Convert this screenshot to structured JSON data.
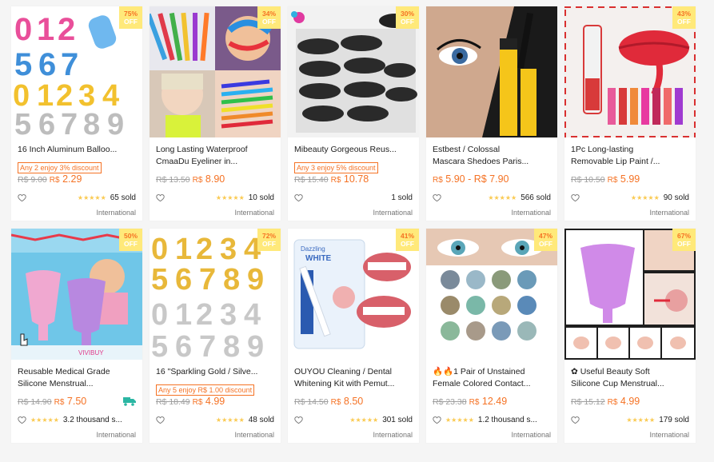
{
  "products": [
    {
      "title": "16 Inch Aluminum Balloo...",
      "title2": "",
      "promo": "Any 2 enjoy 3% discount",
      "old_price": "R$ 9.00",
      "cur": "R$",
      "price": "2.29",
      "stars": "★★★★★",
      "sold": "65 sold",
      "origin": "International",
      "discount_pct": "75%",
      "off": "OFF"
    },
    {
      "title": "Long Lasting Waterproof",
      "title2": "CmaaDu Eyeliner in...",
      "promo": "",
      "old_price": "R$ 13.50",
      "cur": "R$",
      "price": "8.90",
      "stars": "★★★★★",
      "sold": "10 sold",
      "origin": "International",
      "discount_pct": "34%",
      "off": "OFF"
    },
    {
      "title": "Mibeauty Gorgeous Reus...",
      "title2": "",
      "promo": "Any 3 enjoy 5% discount",
      "old_price": "R$ 15.40",
      "cur": "R$",
      "price": "10.78",
      "stars": "",
      "sold": "1 sold",
      "origin": "International",
      "discount_pct": "30%",
      "off": "OFF"
    },
    {
      "title": "Estbest / Colossal",
      "title2": "Mascara Shedoes Paris...",
      "promo": "",
      "old_price": "",
      "cur": "R$",
      "price": "5.90 - R$ 7.90",
      "stars": "★★★★★",
      "sold": "566 sold",
      "origin": "International",
      "discount_pct": "",
      "off": ""
    },
    {
      "title": "1Pc Long-lasting",
      "title2": "Removable Lip Paint /...",
      "promo": "",
      "old_price": "R$ 10.50",
      "cur": "R$",
      "price": "5.99",
      "stars": "★★★★★",
      "sold": "90 sold",
      "origin": "International",
      "discount_pct": "43%",
      "off": "OFF"
    },
    {
      "title": "Reusable Medical Grade",
      "title2": "Silicone Menstrual...",
      "promo": "",
      "old_price": "R$ 14.90",
      "cur": "R$",
      "price": "7.50",
      "stars": "★★★★★",
      "sold": "3.2 thousand s...",
      "origin": "International",
      "discount_pct": "50%",
      "off": "OFF",
      "truck": true
    },
    {
      "title": "16 \"Sparkling Gold / Silve...",
      "title2": "",
      "promo": "Any 5 enjoy R$ 1.00 discount",
      "old_price": "R$ 18.49",
      "cur": "R$",
      "price": "4.99",
      "stars": "★★★★★",
      "sold": "48 sold",
      "origin": "International",
      "discount_pct": "72%",
      "off": "OFF"
    },
    {
      "title": "OUYOU Cleaning / Dental",
      "title2": "Whitening Kit with Pemut...",
      "promo": "",
      "old_price": "R$ 14.50",
      "cur": "R$",
      "price": "8.50",
      "stars": "★★★★★",
      "sold": "301 sold",
      "origin": "International",
      "discount_pct": "41%",
      "off": "OFF"
    },
    {
      "title": "🔥🔥1 Pair of Unstained",
      "title2": "Female Colored Contact...",
      "promo": "",
      "old_price": "R$ 23.38",
      "cur": "R$",
      "price": "12.49",
      "stars": "★★★★★",
      "sold": "1.2 thousand s...",
      "origin": "International",
      "discount_pct": "47%",
      "off": "OFF"
    },
    {
      "title": "✿ Useful Beauty Soft",
      "title2": "Silicone Cup Menstrual...",
      "promo": "",
      "old_price": "R$ 15.12",
      "cur": "R$",
      "price": "4.99",
      "stars": "★★★★★",
      "sold": "179 sold",
      "origin": "International",
      "discount_pct": "67%",
      "off": "OFF"
    }
  ],
  "colors": {
    "accent": "#f57224",
    "badge": "#ffe97a",
    "star": "#faca51"
  },
  "icons": {
    "wishlist": "heart-outline-icon",
    "shipping": "truck-icon"
  }
}
